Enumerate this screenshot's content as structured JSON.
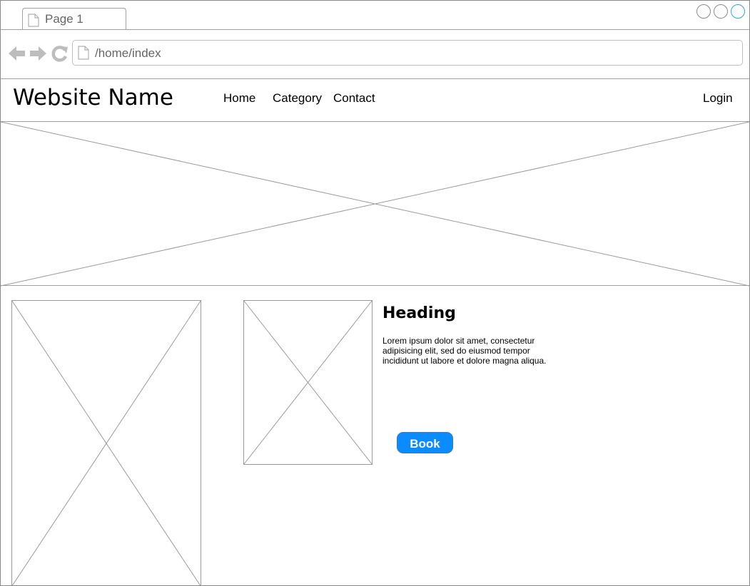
{
  "browser": {
    "tab_title": "Page 1",
    "address": "/home/index"
  },
  "header": {
    "site_name": "Website Name",
    "nav": [
      "Home",
      "Category",
      "Contact"
    ],
    "login": "Login"
  },
  "content": {
    "heading": "Heading",
    "body": "Lorem ipsum dolor sit amet, consectetur adipisicing elit, sed do eiusmod tempor incididunt ut labore et dolore magna aliqua.",
    "button": "Book"
  },
  "colors": {
    "button": "#0a8cff",
    "active_window_button": "#2aa3e8"
  }
}
